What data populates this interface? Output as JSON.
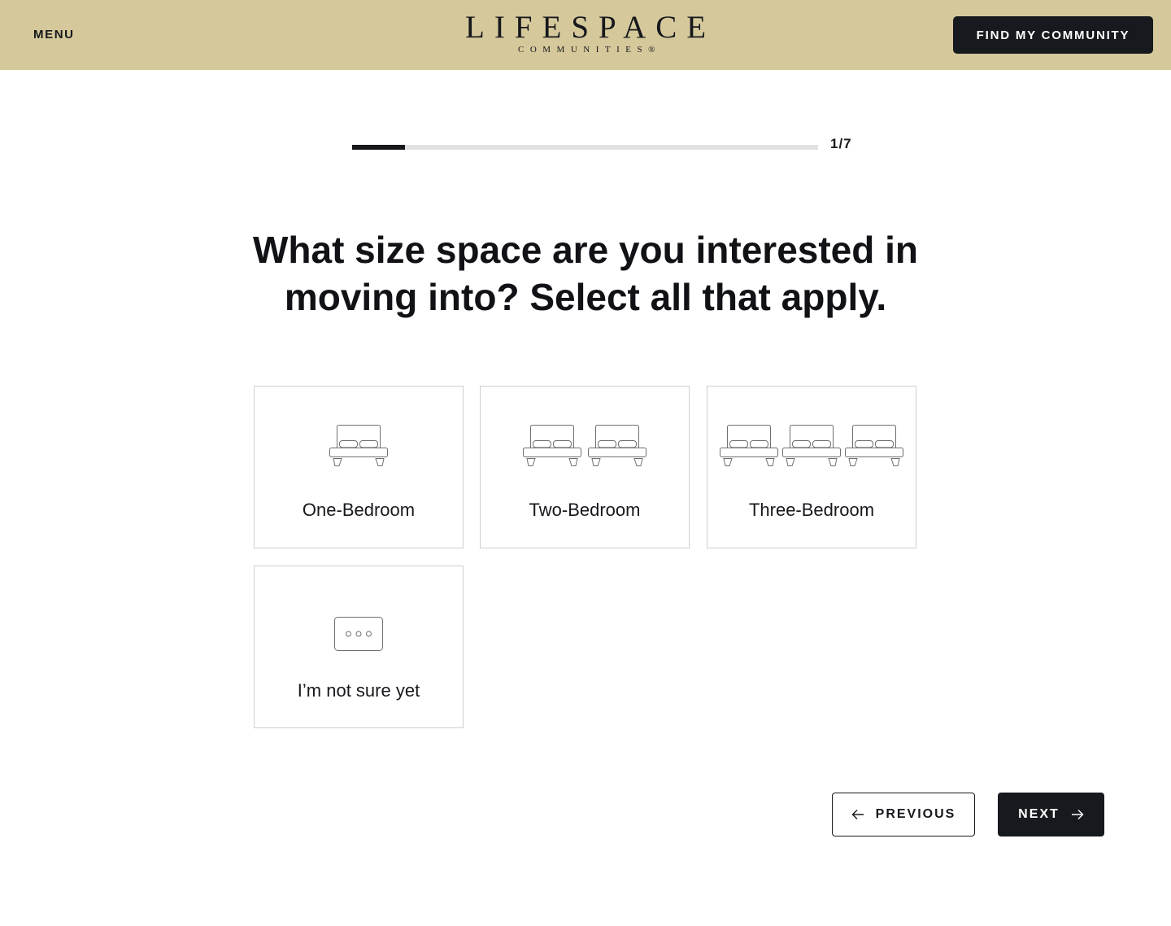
{
  "header": {
    "menu_label": "MENU",
    "logo_main": "LIFESPACE",
    "logo_sub": "COMMUNITIES®",
    "cta_label": "FIND MY COMMUNITY",
    "background_color": "#d5c89b"
  },
  "progress": {
    "label": "1/7",
    "fraction": 0.1143
  },
  "question": "What size space are you interested in moving into? Select all that apply.",
  "options": [
    {
      "label": "One-Bedroom",
      "icon": "bed-icon",
      "icon_count": 1
    },
    {
      "label": "Two-Bedroom",
      "icon": "bed-icon",
      "icon_count": 2
    },
    {
      "label": "Three-Bedroom",
      "icon": "bed-icon",
      "icon_count": 3
    },
    {
      "label": "I’m not sure yet",
      "icon": "ellipsis-box-icon",
      "icon_count": 1
    }
  ],
  "nav": {
    "previous_label": "PREVIOUS",
    "next_label": "NEXT"
  },
  "colors": {
    "dark": "#16191d",
    "accent": "#d5c89b"
  }
}
